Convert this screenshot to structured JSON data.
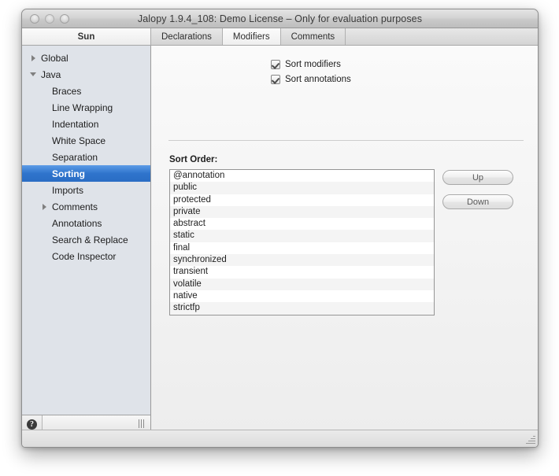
{
  "window": {
    "title": "Jalopy 1.9.4_108:  Demo License – Only for evaluation purposes",
    "controls": {
      "close_label": "close-button",
      "minimize_label": "minimize-button",
      "zoom_label": "zoom-button"
    }
  },
  "tabs": {
    "left_tab_label": "Sun",
    "items": [
      {
        "label": "Declarations",
        "selected": false
      },
      {
        "label": "Modifiers",
        "selected": true
      },
      {
        "label": "Comments",
        "selected": false
      }
    ]
  },
  "sidebar": {
    "tree": [
      {
        "label": "Global",
        "level": 1,
        "twisty": "closed",
        "selected": false
      },
      {
        "label": "Java",
        "level": 1,
        "twisty": "open",
        "selected": false
      },
      {
        "label": "Braces",
        "level": 2,
        "twisty": "none",
        "selected": false
      },
      {
        "label": "Line Wrapping",
        "level": 2,
        "twisty": "none",
        "selected": false
      },
      {
        "label": "Indentation",
        "level": 2,
        "twisty": "none",
        "selected": false
      },
      {
        "label": "White Space",
        "level": 2,
        "twisty": "none",
        "selected": false
      },
      {
        "label": "Separation",
        "level": 2,
        "twisty": "none",
        "selected": false
      },
      {
        "label": "Sorting",
        "level": 2,
        "twisty": "none",
        "selected": true
      },
      {
        "label": "Imports",
        "level": 2,
        "twisty": "none",
        "selected": false
      },
      {
        "label": "Comments",
        "level": 2,
        "twisty": "closed",
        "selected": false
      },
      {
        "label": "Annotations",
        "level": 2,
        "twisty": "none",
        "selected": false
      },
      {
        "label": "Search & Replace",
        "level": 2,
        "twisty": "none",
        "selected": false
      },
      {
        "label": "Code Inspector",
        "level": 2,
        "twisty": "none",
        "selected": false
      }
    ],
    "footer": {
      "help_glyph": "?",
      "help_name": "help-button",
      "grip_name": "splitter-grip"
    },
    "selection_color": "#2f74cc",
    "background_color": "#dfe3e9"
  },
  "content": {
    "checkboxes": [
      {
        "label": "Sort modifiers",
        "checked": true
      },
      {
        "label": "Sort annotations",
        "checked": true
      }
    ],
    "sort_order_label": "Sort Order:",
    "sort_order_items": [
      "@annotation",
      "public",
      "protected",
      "private",
      "abstract",
      "static",
      "final",
      "synchronized",
      "transient",
      "volatile",
      "native",
      "strictfp"
    ],
    "buttons": [
      {
        "label": "Up"
      },
      {
        "label": "Down"
      }
    ]
  }
}
